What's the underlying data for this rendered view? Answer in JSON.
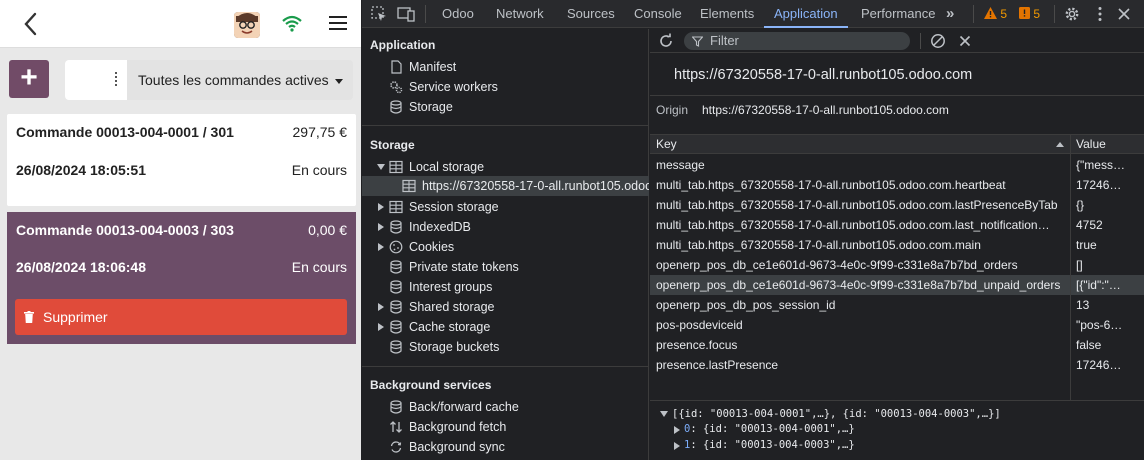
{
  "pos": {
    "filter_label": "Toutes les commandes actives",
    "add_label": "+",
    "orders": [
      {
        "number": "Commande 00013-004-0001 / 301",
        "amount": "297,75 €",
        "date": "26/08/2024 18:05:51",
        "state": "En cours"
      },
      {
        "number": "Commande 00013-004-0003 / 303",
        "amount": "0,00 €",
        "date": "26/08/2024 18:06:48",
        "state": "En cours"
      }
    ],
    "delete_label": "Supprimer"
  },
  "devtools": {
    "tabs": [
      "Odoo",
      "Network",
      "Sources",
      "Console",
      "Elements",
      "Application",
      "Performance"
    ],
    "active_tab": "Application",
    "warnings_count": "5",
    "errors_count": "5",
    "sidebar": {
      "application_title": "Application",
      "application_items": [
        "Manifest",
        "Service workers",
        "Storage"
      ],
      "storage_title": "Storage",
      "local_storage": "Local storage",
      "local_storage_origin": "https://67320558-17-0-all.runbot105.odoo",
      "storage_items": [
        "Session storage",
        "IndexedDB",
        "Cookies",
        "Private state tokens",
        "Interest groups",
        "Shared storage",
        "Cache storage",
        "Storage buckets"
      ],
      "background_title": "Background services",
      "background_items": [
        "Back/forward cache",
        "Background fetch",
        "Background sync"
      ]
    },
    "main": {
      "filter_placeholder": "Filter",
      "url_title": "https://67320558-17-0-all.runbot105.odoo.com",
      "origin_label": "Origin",
      "origin_value": "https://67320558-17-0-all.runbot105.odoo.com",
      "columns": {
        "key": "Key",
        "value": "Value"
      },
      "rows": [
        {
          "key": "message",
          "value": "{\"mess…"
        },
        {
          "key": "multi_tab.https_67320558-17-0-all.runbot105.odoo.com.heartbeat",
          "value": "17246…"
        },
        {
          "key": "multi_tab.https_67320558-17-0-all.runbot105.odoo.com.lastPresenceByTab",
          "value": "{}"
        },
        {
          "key": "multi_tab.https_67320558-17-0-all.runbot105.odoo.com.last_notification…",
          "value": "4752"
        },
        {
          "key": "multi_tab.https_67320558-17-0-all.runbot105.odoo.com.main",
          "value": "true"
        },
        {
          "key": "openerp_pos_db_ce1e601d-9673-4e0c-9f99-c331e8a7b7bd_orders",
          "value": "[]"
        },
        {
          "key": "openerp_pos_db_ce1e601d-9673-4e0c-9f99-c331e8a7b7bd_unpaid_orders",
          "value": "[{\"id\":\"…"
        },
        {
          "key": "openerp_pos_db_pos_session_id",
          "value": "13"
        },
        {
          "key": "pos-posdeviceid",
          "value": "\"pos-6…"
        },
        {
          "key": "presence.focus",
          "value": "false"
        },
        {
          "key": "presence.lastPresence",
          "value": "17246…"
        }
      ],
      "preview": {
        "root": "[{id: \"00013-004-0001\",…}, {id: \"00013-004-0003\",…}]",
        "items": [
          {
            "index": "0",
            "text": "{id: \"00013-004-0001\",…}"
          },
          {
            "index": "1",
            "text": "{id: \"00013-004-0003\",…}"
          }
        ]
      }
    }
  },
  "colors": {
    "odoo_purple": "#714b67",
    "selected_order": "#6c4d68",
    "delete_red": "#e04b3a",
    "devtools_bg": "#202124",
    "devtools_accent": "#8ab4f8"
  }
}
